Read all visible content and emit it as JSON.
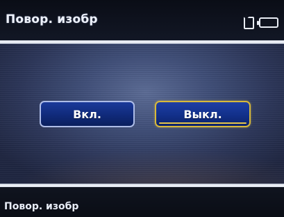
{
  "header": {
    "title": "Повор. изобр",
    "icons": [
      "memory-card-icon",
      "battery-icon"
    ]
  },
  "options": {
    "on_label": "Вкл.",
    "off_label": "Выкл.",
    "selected": "off"
  },
  "footer": {
    "caption": "Повор. изобр"
  },
  "colors": {
    "selection_border": "#d8b93a",
    "button_fill": "#12308a",
    "background": "#2a3354"
  }
}
